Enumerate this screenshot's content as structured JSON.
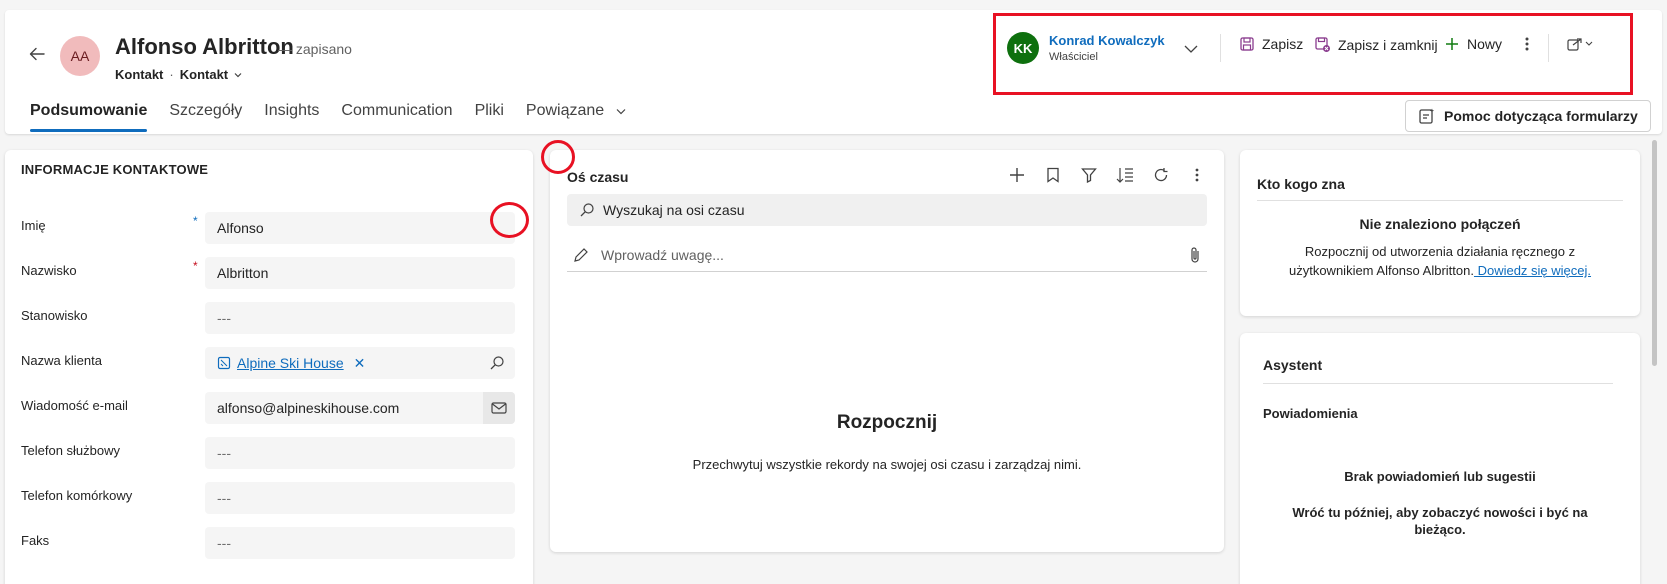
{
  "record": {
    "initials": "AA",
    "name": "Alfonso Albritton",
    "saved_status": "— zapisano",
    "entity": "Kontakt",
    "form": "Kontakt"
  },
  "tabs": [
    {
      "label": "Podsumowanie",
      "active": true
    },
    {
      "label": "Szczegóły"
    },
    {
      "label": "Insights"
    },
    {
      "label": "Communication"
    },
    {
      "label": "Pliki"
    },
    {
      "label": "Powiązane"
    }
  ],
  "commandbar": {
    "owner_initials": "KK",
    "owner_name": "Konrad Kowalczyk",
    "owner_role": "Właściciel",
    "save": "Zapisz",
    "save_close": "Zapisz i zamknij",
    "new": "Nowy"
  },
  "help_button": "Pomoc dotycząca formularzy",
  "contact": {
    "section_title": "INFORMACJE KONTAKTOWE",
    "fields": [
      {
        "label": "Imię",
        "value": "Alfonso",
        "required": "*"
      },
      {
        "label": "Nazwisko",
        "value": "Albritton",
        "required": "*"
      },
      {
        "label": "Stanowisko",
        "value": "---"
      },
      {
        "label": "Nazwa klienta",
        "value": "Alpine Ski House"
      },
      {
        "label": "Wiadomość e-mail",
        "value": "alfonso@alpineskihouse.com"
      },
      {
        "label": "Telefon służbowy",
        "value": "---"
      },
      {
        "label": "Telefon komórkowy",
        "value": "---"
      },
      {
        "label": "Faks",
        "value": "---"
      }
    ]
  },
  "timeline": {
    "title": "Oś czasu",
    "search_placeholder": "Wyszukaj na osi czasu",
    "note_placeholder": "Wprowadź uwagę...",
    "empty_title": "Rozpocznij",
    "empty_text": "Przechwytuj wszystkie rekordy na swojej osi czasu i zarządzaj nimi."
  },
  "who_knows": {
    "title": "Kto kogo zna",
    "empty_title": "Nie znaleziono połączeń",
    "line1": "Rozpocznij od utworzenia działania ręcznego z",
    "line2": "użytkownikiem Alfonso Albritton.",
    "link": " Dowiedz się więcej."
  },
  "assistant": {
    "title": "Asystent",
    "subtitle": "Powiadomienia",
    "empty_title": "Brak powiadomień lub sugestii",
    "line1": "Wróć tu później, aby zobaczyć nowości i być na",
    "line2": "bieżąco."
  },
  "colors": {
    "accent": "#0f6cbd",
    "highlight": "#e81123",
    "avatar_record": "#f1bbbc",
    "avatar_owner": "#0e700e"
  }
}
